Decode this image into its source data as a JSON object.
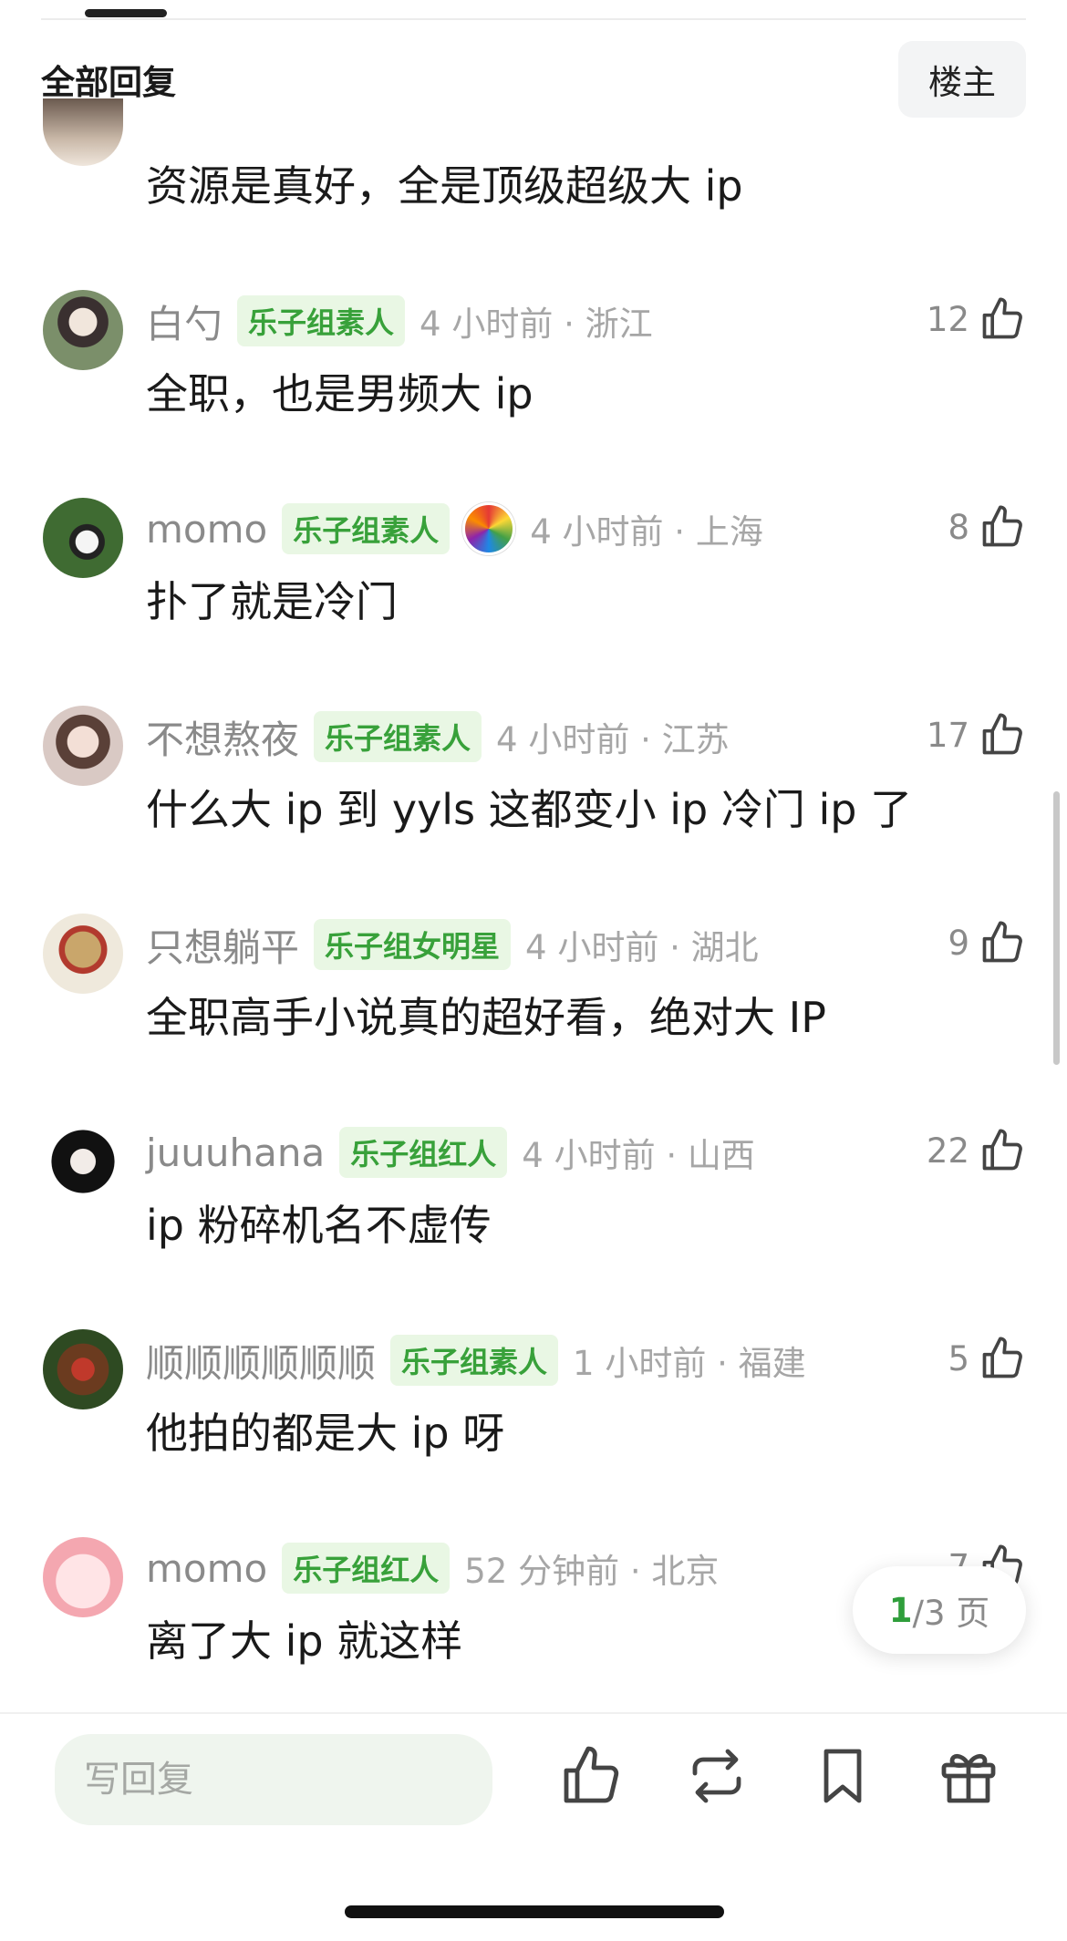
{
  "header": {
    "title": "全部回复",
    "op_button": "楼主"
  },
  "first_comment": {
    "text": "资源是真好，全是顶级超级大 ip"
  },
  "comments": [
    {
      "username": "白勺",
      "badge": "乐子组素人",
      "time": "4 小时前 · 浙江",
      "text": "全职，也是男频大 ip",
      "likes": "12"
    },
    {
      "username": "momo",
      "badge": "乐子组素人",
      "time": "4 小时前 · 上海",
      "text": "扑了就是冷门",
      "likes": "8"
    },
    {
      "username": "不想熬夜",
      "badge": "乐子组素人",
      "time": "4 小时前 · 江苏",
      "text": "什么大 ip 到 yyls 这都变小 ip 冷门 ip 了",
      "likes": "17"
    },
    {
      "username": "只想躺平",
      "badge": "乐子组女明星",
      "time": "4 小时前 · 湖北",
      "text": "全职高手小说真的超好看，绝对大 IP",
      "likes": "9"
    },
    {
      "username": "juuuhana",
      "badge": "乐子组红人",
      "time": "4 小时前 · 山西",
      "text": "ip 粉碎机名不虚传",
      "likes": "22"
    },
    {
      "username": "顺顺顺顺顺顺",
      "badge": "乐子组素人",
      "time": "1 小时前 · 福建",
      "text": "他拍的都是大 ip 呀",
      "likes": "5"
    },
    {
      "username": "momo",
      "badge": "乐子组红人",
      "time": "52 分钟前 · 北京",
      "text": "离了大 ip 就这样",
      "likes": "7"
    }
  ],
  "pagination": {
    "current": "1",
    "total_label": "/3 页"
  },
  "bottom_bar": {
    "reply_placeholder": "写回复"
  },
  "colors": {
    "badge_text": "#38a13a",
    "badge_bg": "#e9f7e4",
    "accent": "#2f9e3b"
  }
}
